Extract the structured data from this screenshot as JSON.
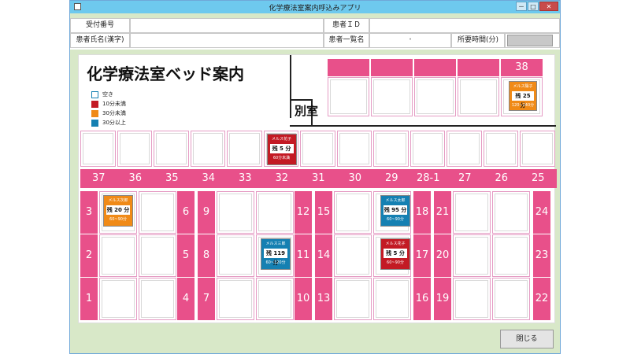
{
  "window": {
    "title": "化学療法室案内呼込みアプリ",
    "min_label": "－",
    "max_label": "□",
    "close_label": "✕"
  },
  "header": {
    "reception_no_label": "受付番号",
    "reception_no_value": "",
    "patient_id_label": "患者ＩＤ",
    "patient_id_value": "",
    "patient_name_label": "患者氏名(漢字)",
    "patient_name_value": "",
    "patient_list_label": "患者一覧名",
    "patient_list_value": "・",
    "required_time_label": "所要時間(分)"
  },
  "board": {
    "title": "化学療法室ベッド案内",
    "annex_label": "別室",
    "legend": [
      {
        "label": "空き",
        "color": "#ffffff"
      },
      {
        "label": "10分未満",
        "color": "#c31a24"
      },
      {
        "label": "30分未満",
        "color": "#f08a17"
      },
      {
        "label": "30分以上",
        "color": "#1580b2"
      }
    ]
  },
  "annex_bed": {
    "number": "38"
  },
  "top_numbers": [
    "37",
    "36",
    "35",
    "34",
    "33",
    "32",
    "31",
    "30",
    "29",
    "28-1",
    "27",
    "26",
    "25"
  ],
  "left_cols": [
    {
      "top": "3",
      "mid": "2",
      "bot": "1"
    },
    {
      "top": "6",
      "mid": "5",
      "bot": "4"
    },
    {
      "top": "9",
      "mid": "8",
      "bot": "7"
    },
    {
      "top": "12",
      "mid": "11",
      "bot": "10"
    },
    {
      "top": "15",
      "mid": "14",
      "bot": "13"
    },
    {
      "top": "18",
      "mid": "17",
      "bot": "16"
    },
    {
      "top": "21",
      "mid": "20",
      "bot": "19"
    },
    {
      "top": "24",
      "mid": "23",
      "bot": "22"
    }
  ],
  "cards": {
    "bed38": {
      "name": "メルス陽子",
      "remain": "残 25 分",
      "range": "120~240分",
      "color": "orange"
    },
    "bed32": {
      "name": "メルス花子",
      "remain": "残 5 分",
      "range": "60分未満",
      "color": "red"
    },
    "bed3": {
      "name": "メルス次郎",
      "remain": "残 20 分",
      "range": "60~90分",
      "color": "orange"
    },
    "bed15": {
      "name": "メルス太郎",
      "remain": "残 95 分",
      "range": "60~90分",
      "color": "blue"
    },
    "bed8": {
      "name": "メルス三郎",
      "remain": "残 119 分",
      "range": "60~120分",
      "color": "blue"
    },
    "bed14": {
      "name": "メルス花子",
      "remain": "残 5 分",
      "range": "60~90分",
      "color": "red"
    }
  },
  "footer": {
    "close_label": "閉じる"
  }
}
